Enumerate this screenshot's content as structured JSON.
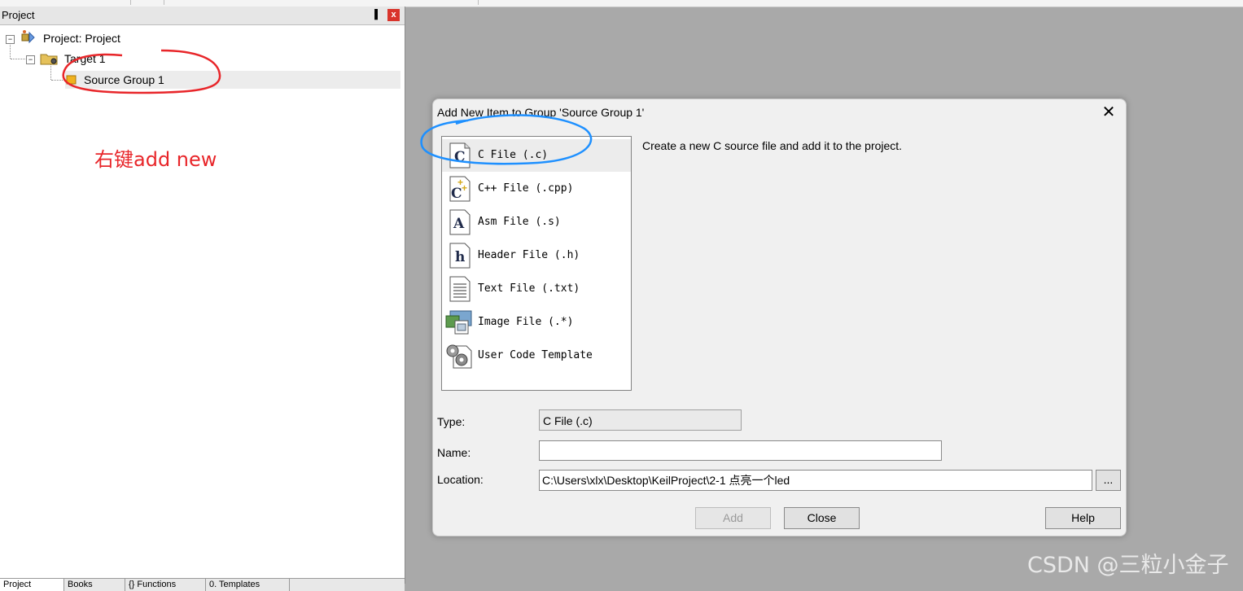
{
  "project_panel": {
    "title": "Project",
    "pin_glyph": "▐",
    "close_glyph": "x",
    "tree": {
      "root_label": "Project: Project",
      "target_label": "Target 1",
      "group_label": "Source Group 1",
      "collapse_glyph": "−"
    },
    "annotation": "右键add new",
    "bottom_tabs": [
      "Project",
      "Books",
      "{} Functions",
      "0. Templates"
    ]
  },
  "dialog": {
    "title": "Add New Item to Group 'Source Group 1'",
    "close_glyph": "✕",
    "items": [
      {
        "label": "C File (.c)",
        "icon": "c-file-icon",
        "icon_glyph": "C",
        "selected": true
      },
      {
        "label": "C++ File (.cpp)",
        "icon": "cpp-file-icon",
        "icon_glyph": "C",
        "selected": false
      },
      {
        "label": "Asm File (.s)",
        "icon": "asm-file-icon",
        "icon_glyph": "A",
        "selected": false
      },
      {
        "label": "Header File (.h)",
        "icon": "header-file-icon",
        "icon_glyph": "h",
        "selected": false
      },
      {
        "label": "Text File (.txt)",
        "icon": "text-file-icon",
        "icon_glyph": "",
        "selected": false
      },
      {
        "label": "Image File (.*)",
        "icon": "image-file-icon",
        "icon_glyph": "",
        "selected": false
      },
      {
        "label": "User Code Template",
        "icon": "user-code-template-icon",
        "icon_glyph": "",
        "selected": false
      }
    ],
    "description": "Create a new C source file and add it to the project.",
    "type_label": "Type:",
    "type_value": "C File (.c)",
    "name_label": "Name:",
    "name_value": "",
    "location_label": "Location:",
    "location_value": "C:\\Users\\xlx\\Desktop\\KeilProject\\2-1  点亮一个led",
    "browse_label": "...",
    "add_label": "Add",
    "close_label": "Close",
    "help_label": "Help"
  },
  "watermark": "CSDN @三粒小金子",
  "colors": {
    "annotation_red": "#e8262a",
    "highlight_blue": "#1e90ff",
    "background_gray": "#a9a9a9"
  }
}
